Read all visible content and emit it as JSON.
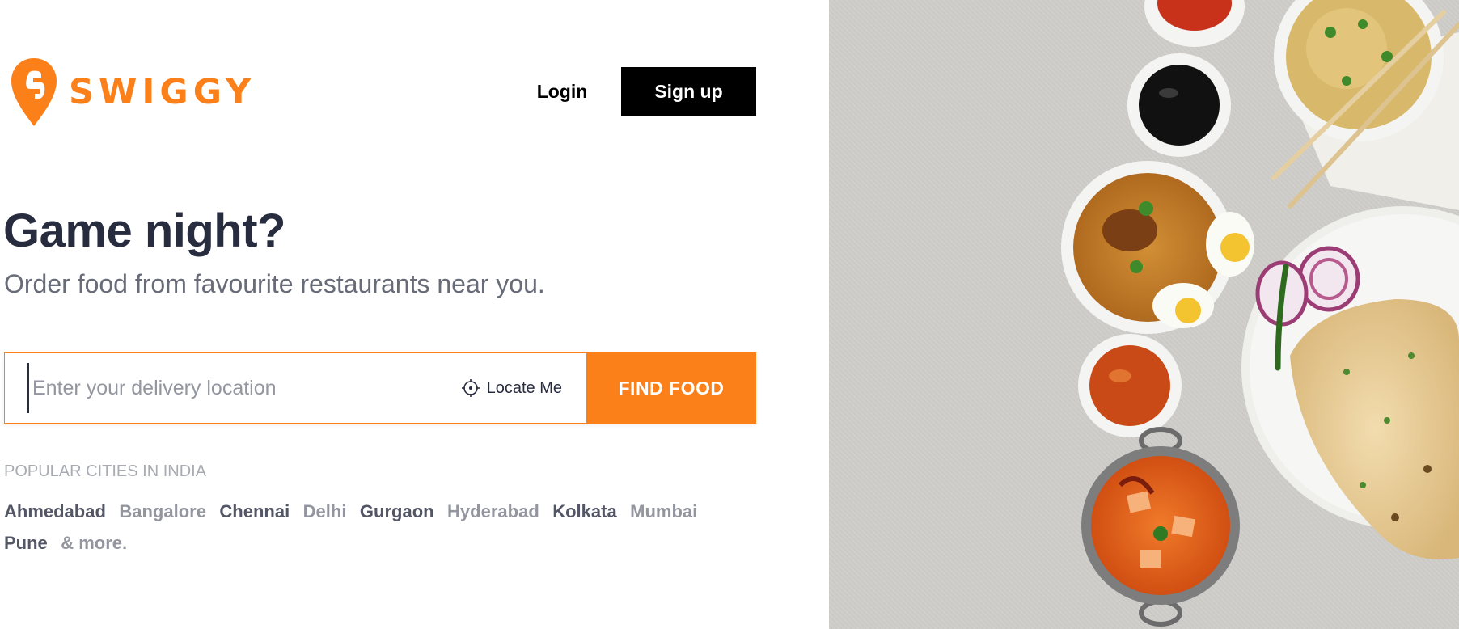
{
  "brand": {
    "name": "SWIGGY",
    "color": "#fc8019",
    "logo_icon": "swiggy-logo-icon"
  },
  "header": {
    "login_label": "Login",
    "signup_label": "Sign up"
  },
  "hero": {
    "headline": "Game night?",
    "subheadline": "Order food from favourite restaurants near you."
  },
  "search": {
    "placeholder": "Enter your delivery location",
    "value": "",
    "locate_label": "Locate Me",
    "locate_icon": "crosshair-icon",
    "submit_label": "FIND FOOD"
  },
  "popular": {
    "title": "POPULAR CITIES IN INDIA",
    "cities": [
      {
        "label": "Ahmedabad"
      },
      {
        "label": "Bangalore"
      },
      {
        "label": "Chennai"
      },
      {
        "label": "Delhi"
      },
      {
        "label": "Gurgaon"
      },
      {
        "label": "Hyderabad"
      },
      {
        "label": "Kolkata"
      },
      {
        "label": "Mumbai"
      },
      {
        "label": "Pune"
      },
      {
        "label": "& more."
      }
    ]
  },
  "colors": {
    "text_dark": "#282c3f",
    "text_muted": "#686b78",
    "city_dark": "#535665",
    "city_light": "#93959f",
    "tablecloth": "#cfceca"
  }
}
